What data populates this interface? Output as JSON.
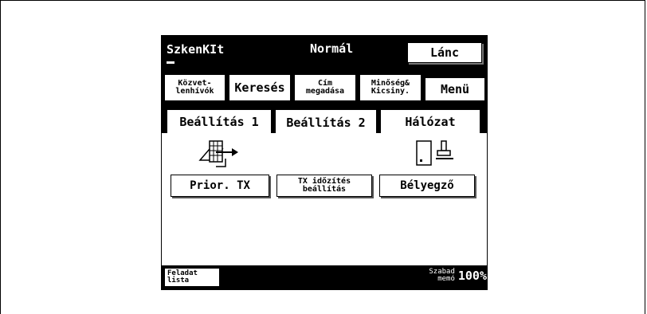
{
  "header": {
    "title": "SzkenKIt",
    "mode": "Normál",
    "chain_button": "Lánc"
  },
  "toolbar": {
    "buttons": [
      "Közvet-\nlenhívók",
      "Keresés",
      "Cím\nmegadása",
      "Minőség&\nKicsiny.",
      "Menü"
    ]
  },
  "tabs": [
    "Beállítás 1",
    "Beállítás 2",
    "Hálózat"
  ],
  "active_tab": "Beállítás 2",
  "settings": {
    "buttons": [
      {
        "label": "Prior. TX",
        "icon": "priority-tx-icon"
      },
      {
        "label": "TX időzítés\nbeállítás",
        "icon": ""
      },
      {
        "label": "Bélyegző",
        "icon": "stamp-icon"
      }
    ]
  },
  "footer": {
    "job_list": "Feladat\nlista",
    "free_memory_label": "Szabad\nmemó",
    "free_memory_value": "100%"
  }
}
